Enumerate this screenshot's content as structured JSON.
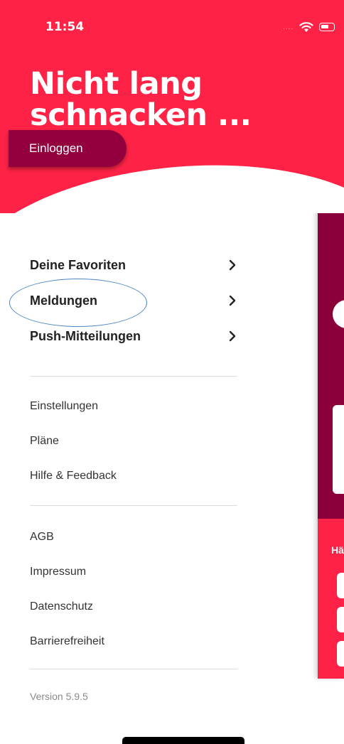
{
  "status_bar": {
    "time": "11:54",
    "signal": "....",
    "wifi_icon": "wifi-icon",
    "battery_icon": "battery-icon"
  },
  "header": {
    "title_line1": "Nicht lang",
    "title_line2": "schnacken ...",
    "login_label": "Einloggen"
  },
  "menu_primary": [
    {
      "label": "Deine Favoriten"
    },
    {
      "label": "Meldungen"
    },
    {
      "label": "Push-Mitteilungen"
    }
  ],
  "menu_secondary": [
    {
      "label": "Einstellungen"
    },
    {
      "label": "Pläne"
    },
    {
      "label": "Hilfe & Feedback"
    }
  ],
  "menu_legal": [
    {
      "label": "AGB"
    },
    {
      "label": "Impressum"
    },
    {
      "label": "Datenschutz"
    },
    {
      "label": "Barrierefreiheit"
    }
  ],
  "version": "Version 5.9.5",
  "background_panel": {
    "partial_text": "Hä"
  },
  "colors": {
    "brand_red": "#fe2346",
    "login_maroon": "#93003d",
    "highlight_blue": "#4a87c5"
  }
}
